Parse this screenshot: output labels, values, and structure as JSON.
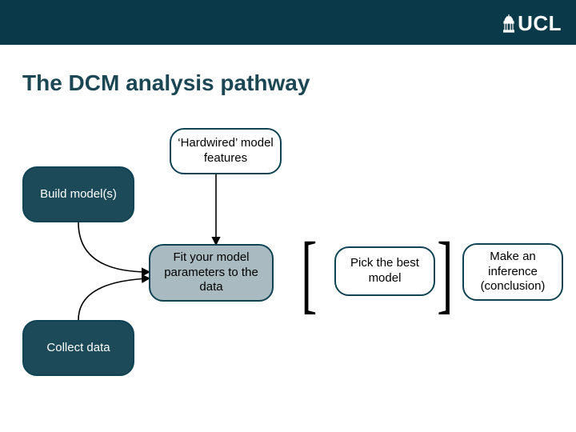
{
  "header": {
    "logo_text": "UCL"
  },
  "title": "The DCM analysis pathway",
  "nodes": {
    "build": "Build model(s)",
    "hardwired": "‘Hardwired’ model features",
    "fit": "Fit your model parameters to the data",
    "collect": "Collect data",
    "pick": "Pick the best model",
    "infer": "Make an inference (conclusion)"
  },
  "brackets": {
    "left": "[",
    "right": "]"
  }
}
